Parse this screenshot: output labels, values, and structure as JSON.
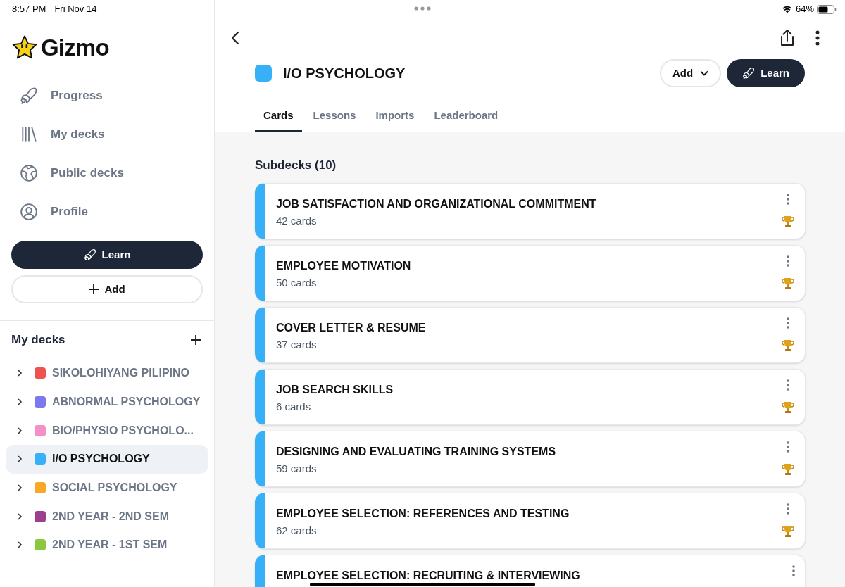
{
  "status_bar": {
    "time": "8:57 PM",
    "date": "Fri Nov 14",
    "battery": "64%"
  },
  "sidebar": {
    "logo": "Gizmo",
    "nav": [
      {
        "label": "Progress"
      },
      {
        "label": "My decks"
      },
      {
        "label": "Public decks"
      },
      {
        "label": "Profile"
      }
    ],
    "learn_button": "Learn",
    "add_button": "Add",
    "decks_heading": "My decks",
    "decks": [
      {
        "name": "SIKOLOHIYANG PILIPINO",
        "color": "#ef5350",
        "selected": false
      },
      {
        "name": "ABNORMAL PSYCHOLOGY",
        "color": "#7c79f0",
        "selected": false
      },
      {
        "name": "BIO/PHYSIO PSYCHOLO...",
        "color": "#f48fc8",
        "selected": false
      },
      {
        "name": "I/O PSYCHOLOGY",
        "color": "#38b0f8",
        "selected": true
      },
      {
        "name": "SOCIAL PSYCHOLOGY",
        "color": "#f8a825",
        "selected": false
      },
      {
        "name": "2ND YEAR - 2ND SEM",
        "color": "#9c3f8f",
        "selected": false
      },
      {
        "name": "2ND YEAR - 1ST SEM",
        "color": "#8dc63f",
        "selected": false
      }
    ]
  },
  "deck": {
    "title": "I/O PSYCHOLOGY",
    "color": "#38b0f8",
    "add_button": "Add",
    "learn_button": "Learn"
  },
  "tabs": [
    {
      "label": "Cards",
      "selected": true
    },
    {
      "label": "Lessons",
      "selected": false
    },
    {
      "label": "Imports",
      "selected": false
    },
    {
      "label": "Leaderboard",
      "selected": false
    }
  ],
  "subdecks_heading": "Subdecks (10)",
  "subdecks": [
    {
      "title": "JOB SATISFACTION AND ORGANIZATIONAL COMMITMENT",
      "count": "42 cards"
    },
    {
      "title": "EMPLOYEE MOTIVATION",
      "count": "50 cards"
    },
    {
      "title": "COVER LETTER & RESUME",
      "count": "37 cards"
    },
    {
      "title": "JOB SEARCH SKILLS",
      "count": "6 cards"
    },
    {
      "title": "DESIGNING AND EVALUATING TRAINING SYSTEMS",
      "count": "59 cards"
    },
    {
      "title": "EMPLOYEE SELECTION: REFERENCES AND TESTING",
      "count": "62 cards"
    },
    {
      "title": "EMPLOYEE SELECTION: RECRUITING & INTERVIEWING"
    }
  ]
}
